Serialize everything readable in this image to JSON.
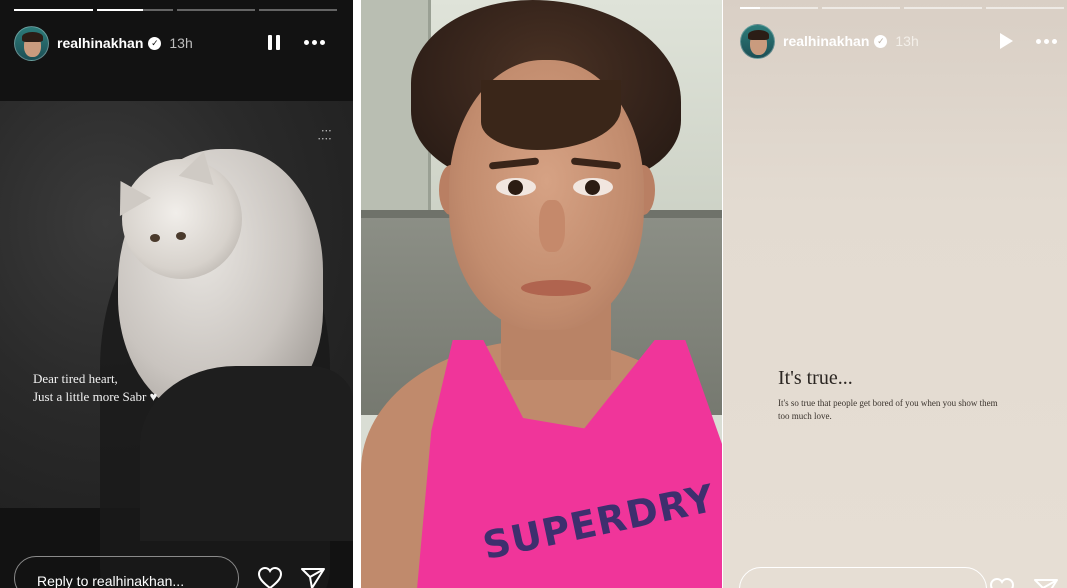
{
  "stories": [
    {
      "id": "left",
      "progress": [
        1,
        0.6,
        0,
        0
      ],
      "username": "realhinakhan",
      "time": "13h",
      "control": "pause-icon",
      "caption_lines": [
        "Dear tired heart,",
        "Just a little more Sabr ♥"
      ],
      "reply_placeholder": "Reply to realhinakhan...",
      "colors": {
        "text": "#ffffff",
        "bg": "#121212"
      }
    },
    {
      "id": "middle",
      "photo_text": "SUPERDRY"
    },
    {
      "id": "right",
      "progress": [
        0.15,
        0,
        0,
        0,
        0
      ],
      "username": "realhinakhan",
      "time": "13h",
      "control": "play-icon",
      "caption_title": "It's true...",
      "caption_body": "It's so true that people get bored of you when you show them too much love.",
      "colors": {
        "text": "#ffffff",
        "caption": "#2b2622"
      }
    }
  ],
  "icons": {
    "verified": "verified-badge-icon",
    "more": "more-options-icon",
    "like": "heart-icon",
    "send": "send-icon"
  }
}
